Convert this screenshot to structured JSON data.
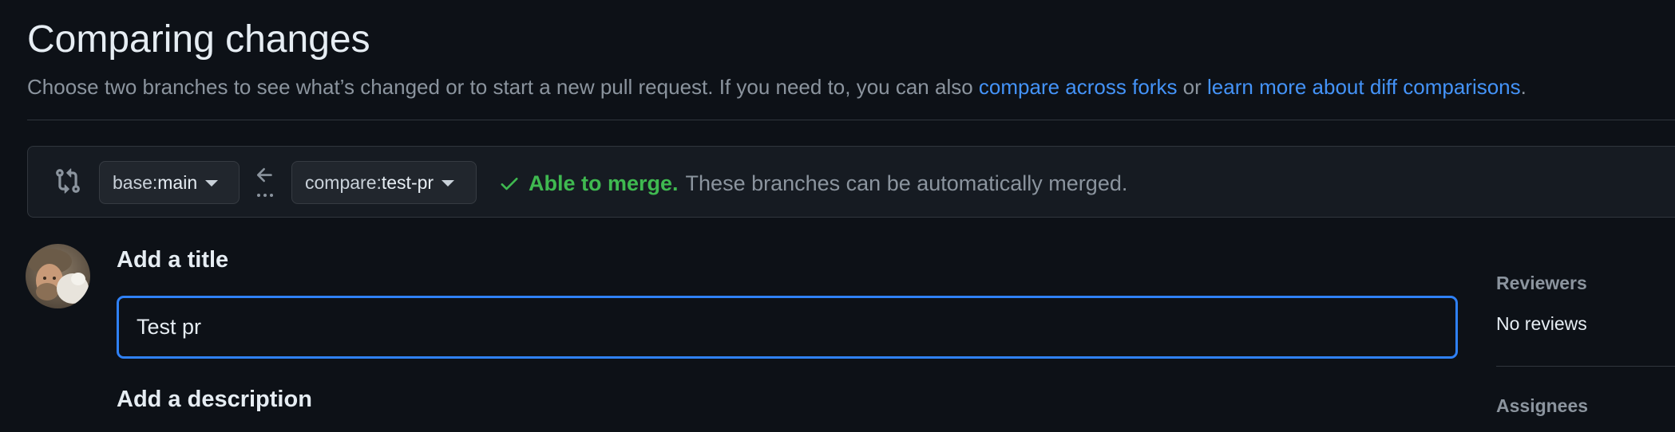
{
  "header": {
    "title": "Comparing changes",
    "subtitle_text": "Choose two branches to see what’s changed or to start a new pull request. If you need to, you can also ",
    "compare_forks_link": "compare across forks",
    "or_text": " or ",
    "learn_more_link": "learn more about diff comparisons",
    "end_text": "."
  },
  "range": {
    "compare_icon": "git-compare-icon",
    "base_prefix": "base: ",
    "base_ref": "main",
    "arrow_icon": "arrow-left-icon",
    "dots_icon": "ellipsis-icon",
    "compare_prefix": "compare: ",
    "compare_ref": "test-pr",
    "merge_icon": "check-icon",
    "merge_status": "Able to merge.",
    "merge_description": "These branches can be automatically merged."
  },
  "form": {
    "title_label": "Add a title",
    "title_value": "Test pr",
    "description_label": "Add a description"
  },
  "sidebar": {
    "reviewers_heading": "Reviewers",
    "reviewers_value": "No reviews",
    "assignees_heading": "Assignees"
  },
  "colors": {
    "background": "#0d1117",
    "link": "#4493f8",
    "success": "#3fb950",
    "focus_border": "#2f81f7",
    "muted_text": "#8b949e"
  }
}
